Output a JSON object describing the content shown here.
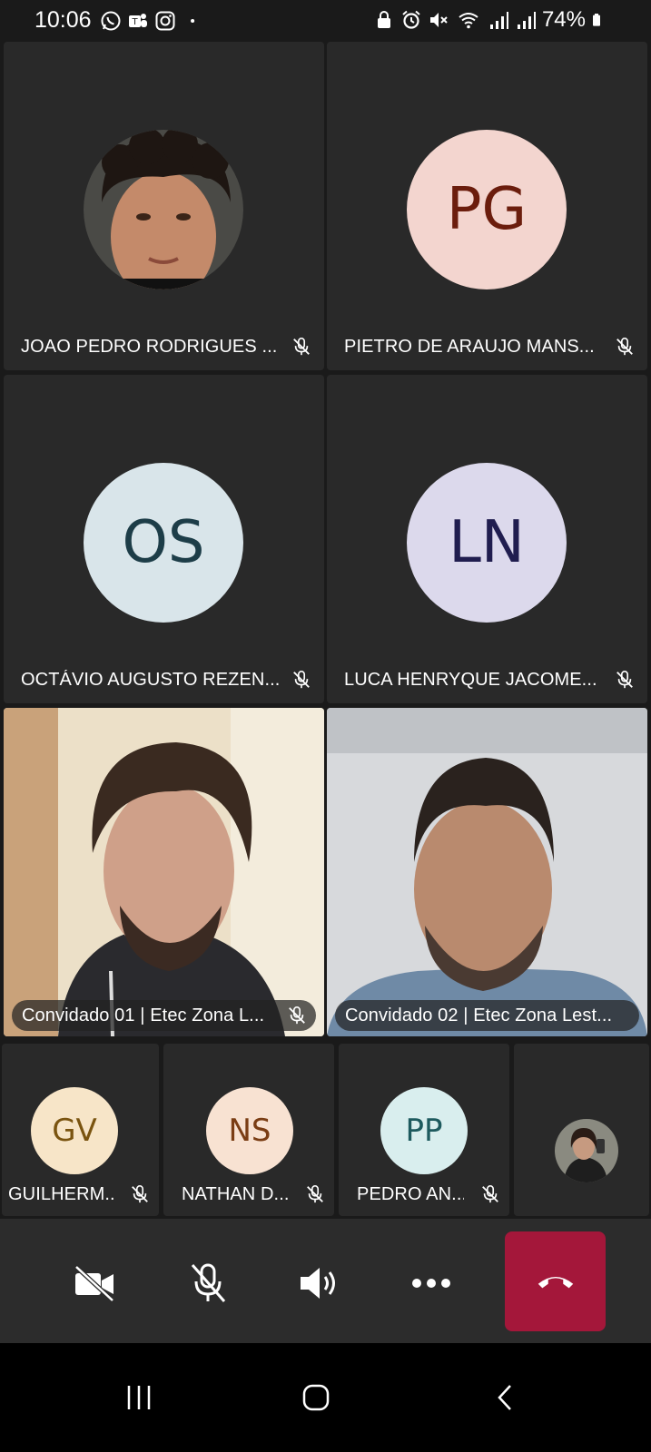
{
  "status_bar": {
    "time": "10:06",
    "battery": "74%",
    "left_icons": [
      "whatsapp-icon",
      "teams-icon",
      "instagram-icon",
      "dot-icon"
    ],
    "right_icons": [
      "lock-icon",
      "alarm-icon",
      "mute-icon",
      "wifi-icon",
      "signal-icon",
      "signal-icon",
      "battery-icon"
    ]
  },
  "participants": [
    {
      "name": "JOAO PEDRO RODRIGUES ...",
      "type": "photo",
      "muted": true
    },
    {
      "name": "PIETRO DE ARAUJO MANS...",
      "initials": "PG",
      "bg": "#f3d5cf",
      "fg": "#6b1d0d",
      "muted": true
    },
    {
      "name": "OCTÁVIO AUGUSTO REZEN...",
      "initials": "OS",
      "bg": "#d9e5ea",
      "fg": "#1d3d48",
      "muted": true
    },
    {
      "name": "LUCA HENRYQUE JACOME...",
      "initials": "LN",
      "bg": "#dcd9ec",
      "fg": "#201d4f",
      "muted": true
    },
    {
      "name": "Convidado 01 | Etec Zona L...",
      "type": "video",
      "muted": true
    },
    {
      "name": "Convidado 02 | Etec Zona Lest...",
      "type": "video",
      "muted": false
    }
  ],
  "small_participants": [
    {
      "name": "GUILHERM...",
      "initials": "GV",
      "bg": "#f7e5c8",
      "fg": "#7a5410",
      "muted": true
    },
    {
      "name": "NATHAN D...",
      "initials": "NS",
      "bg": "#f8e2d2",
      "fg": "#7a3d14",
      "muted": true
    },
    {
      "name": "PEDRO AN...",
      "initials": "PP",
      "bg": "#d9eeee",
      "fg": "#1d5a5e",
      "muted": true
    },
    {
      "name": "",
      "type": "photo",
      "muted": false
    }
  ],
  "controls": {
    "camera": "camera-off-icon",
    "mic": "mic-off-icon",
    "speaker": "speaker-icon",
    "more": "more-icon",
    "hangup": "hangup-icon",
    "accent": "#a4173a"
  },
  "nav": [
    "recent-apps-icon",
    "home-icon",
    "back-icon"
  ]
}
